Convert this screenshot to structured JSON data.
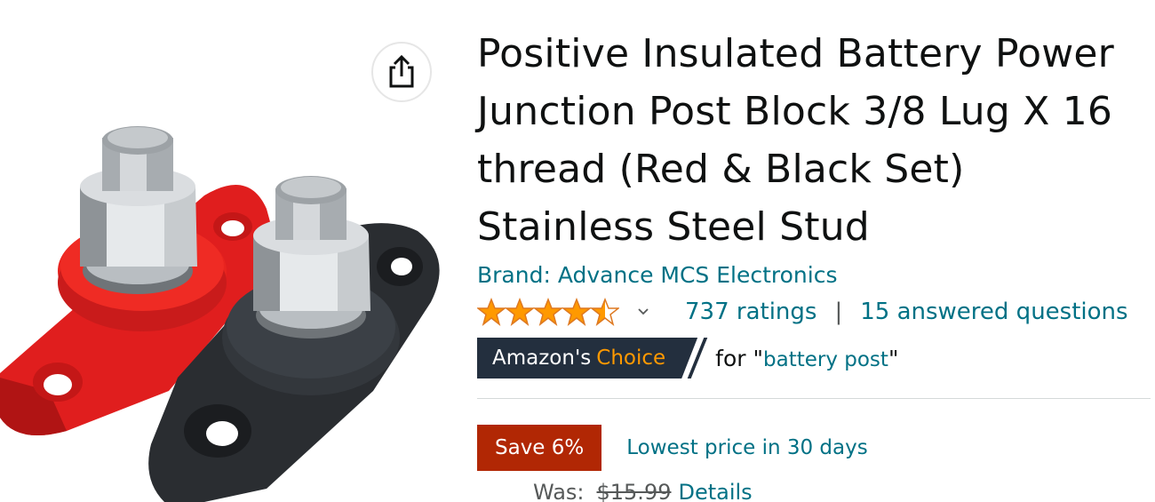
{
  "product": {
    "title": "Positive Insulated Battery Power Junction Post Block 3/8 Lug X 16 thread (Red & Black Set) Stainless Steel Stud",
    "brand": "Brand: Advance MCS Electronics",
    "rating_stars": 4.5,
    "ratings_label": "737 ratings",
    "separator": "|",
    "answered_label": "15 answered questions"
  },
  "badge": {
    "prefix": "Amazon's",
    "choice": "Choice",
    "for_prefix": "for \"",
    "query": "battery post",
    "for_suffix": "\""
  },
  "deal": {
    "save_label": "Save 6%",
    "lowest_label": "Lowest price in 30 days"
  },
  "price": {
    "was_label": "Was:",
    "was_value": "$15.99",
    "details_label": "Details"
  },
  "colors": {
    "link": "#007185",
    "star": "#ff9900",
    "badge_bg": "#232f3e",
    "save_bg": "#b12704"
  },
  "icons": {
    "share": "share-icon",
    "chevron": "chevron-down-icon"
  }
}
